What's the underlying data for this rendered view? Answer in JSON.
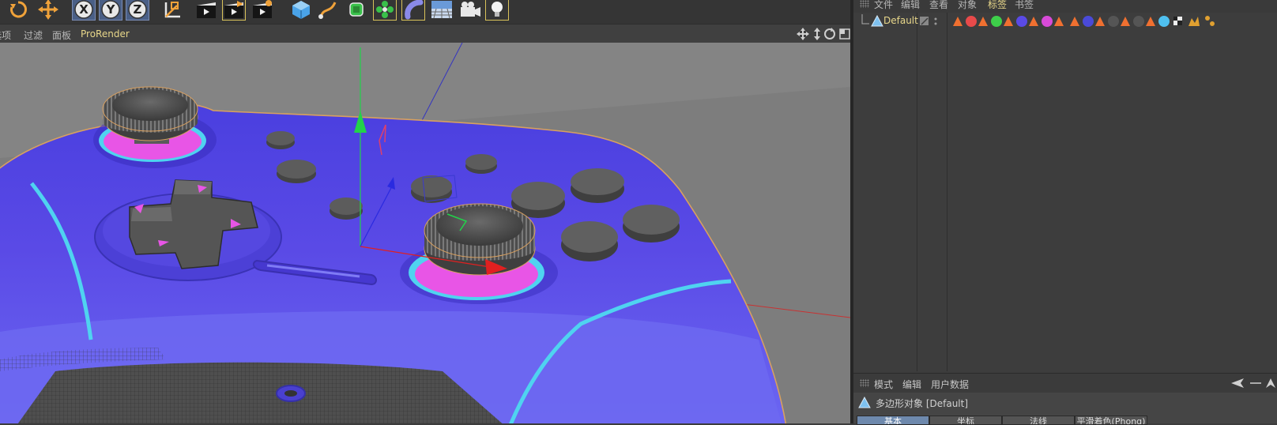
{
  "toolbar": {
    "axis_labels": [
      "X",
      "Y",
      "Z"
    ]
  },
  "viewport_menu": {
    "items": [
      "选项",
      "过滤",
      "面板",
      "ProRender"
    ]
  },
  "object_manager": {
    "menu": [
      "文件",
      "编辑",
      "查看",
      "对象",
      "标签",
      "书签"
    ],
    "active_menu_color": "#e8d78a",
    "object_name": "Default"
  },
  "attribute_manager": {
    "menu": [
      "模式",
      "编辑",
      "用户数据"
    ],
    "object_title": "多边形对象 [Default]",
    "tabs": [
      "基本",
      "坐标",
      "法线",
      "平滑着色(Phong)"
    ],
    "active_tab": "基本"
  },
  "colors": {
    "controller_body": "#5a4ae6",
    "accent_cyan": "#4fd3f0",
    "stick_base": "#e855e6",
    "button_gray": "#5c5c5c",
    "axis_y": "#22d34a",
    "axis_x": "#e02020",
    "axis_z": "#2a2ae0"
  }
}
